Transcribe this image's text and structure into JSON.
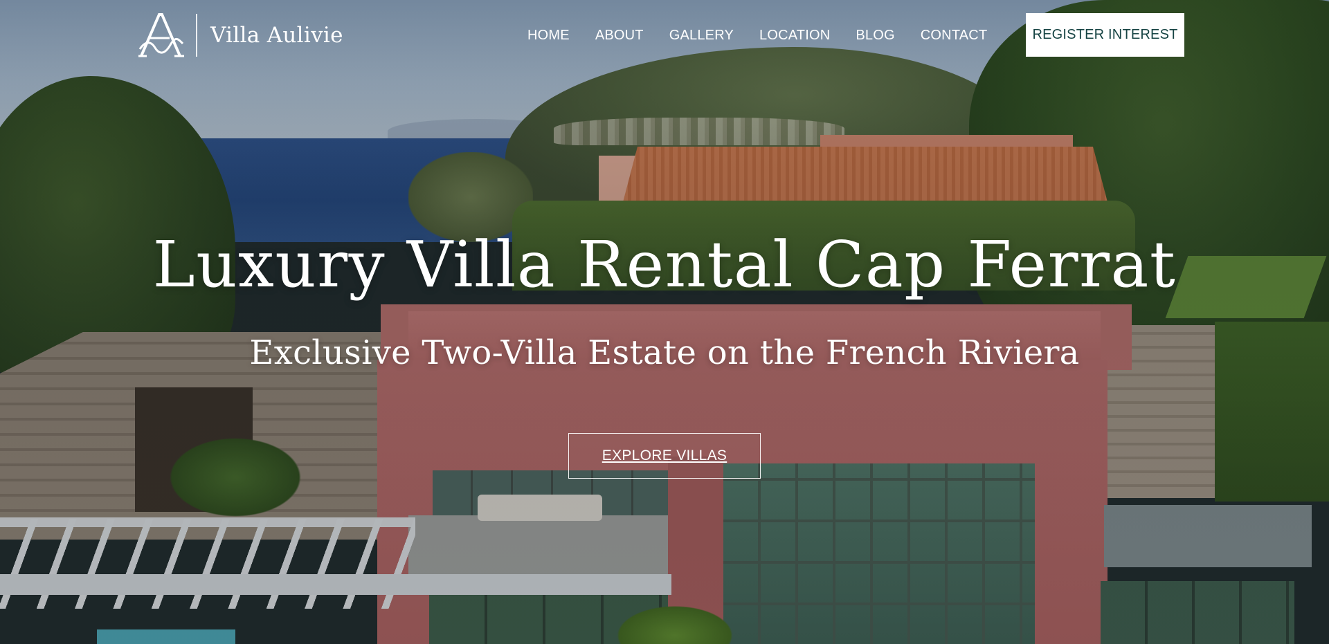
{
  "brand": {
    "name": "Villa Aulivie",
    "logo_icon": "villa-aulivie-monogram-icon"
  },
  "nav": {
    "items": [
      {
        "label": "HOME"
      },
      {
        "label": "ABOUT"
      },
      {
        "label": "GALLERY"
      },
      {
        "label": "LOCATION"
      },
      {
        "label": "BLOG"
      },
      {
        "label": "CONTACT"
      }
    ]
  },
  "header": {
    "cta_label": "REGISTER INTEREST"
  },
  "hero": {
    "title": "Luxury Villa Rental Cap Ferrat",
    "subtitle": "Exclusive Two-Villa Estate on the French Riviera",
    "cta_label": "EXPLORE VILLAS"
  },
  "colors": {
    "cta_text": "#174444",
    "cta_background": "#ffffff",
    "text": "#ffffff"
  }
}
